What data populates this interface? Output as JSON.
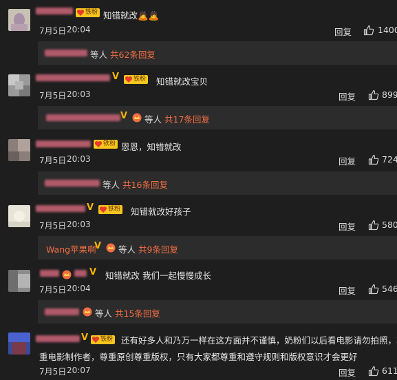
{
  "comments": [
    {
      "text": "知错就改🙇🙇",
      "date": "7月5日",
      "time": "20:04",
      "reply_label": "回复",
      "likes": "1400",
      "fan_label": "铁粉",
      "sub": {
        "etc": "等人",
        "count": "共62条回复"
      }
    },
    {
      "text": "知错就改宝贝",
      "date": "7月5日",
      "time": "20:03",
      "reply_label": "回复",
      "likes": "899",
      "fan_label": "铁粉",
      "sub": {
        "etc": "等人",
        "count": "共17条回复"
      }
    },
    {
      "text": "恩恩，知错就改",
      "date": "7月5日",
      "time": "20:03",
      "reply_label": "回复",
      "likes": "724",
      "fan_label": "铁粉",
      "sub": {
        "etc": "等人",
        "count": "共16条回复"
      }
    },
    {
      "text": "知错就改好孩子",
      "date": "7月5日",
      "time": "20:03",
      "reply_label": "回复",
      "likes": "580",
      "fan_label": "铁粉",
      "sub": {
        "name": "Wang苹果啊",
        "etc": "等人",
        "count": "共9条回复"
      }
    },
    {
      "text": "知错就改 我们一起慢慢成长",
      "date": "7月5日",
      "time": "20:04",
      "reply_label": "回复",
      "likes": "546",
      "sub": {
        "etc": "等人",
        "count": "共15条回复"
      }
    },
    {
      "text_line1": "还有好多人和乃万一样在这方面并不谨慎，奶粉们以后看电影请勿拍照，尊",
      "text_line2": "重电影制作者，尊重原创尊重版权，只有大家都尊重和遵守规则和版权意识才会更好",
      "date": "7月5日",
      "time": "20:07",
      "reply_label": "回复",
      "likes": "611",
      "fan_label": "铁粉"
    }
  ],
  "colors": {
    "accent_reply_count": "#f26d44",
    "fan_badge": "#f7c51e",
    "v_badge": "#f5b400",
    "background": "#1e1e1e"
  }
}
